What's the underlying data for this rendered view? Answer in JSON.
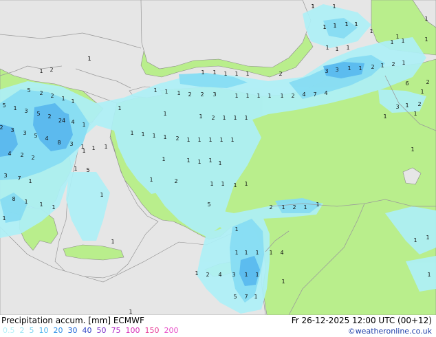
{
  "footer": {
    "title": "Precipitation accum. [mm] ECMWF",
    "valid": "Fr 26-12-2025 12:00 UTC (00+12)",
    "credit": "©weatheronline.co.uk"
  },
  "legend": [
    {
      "label": "0.5",
      "color": "#b5f0f8"
    },
    {
      "label": "2",
      "color": "#9be6f5"
    },
    {
      "label": "5",
      "color": "#7fd6f2"
    },
    {
      "label": "10",
      "color": "#4fb6ee"
    },
    {
      "label": "20",
      "color": "#2e8fe6"
    },
    {
      "label": "30",
      "color": "#1f66d8"
    },
    {
      "label": "40",
      "color": "#2a3fc4"
    },
    {
      "label": "50",
      "color": "#7a2fc8"
    },
    {
      "label": "75",
      "color": "#b52fc8"
    },
    {
      "label": "100",
      "color": "#d82fb8"
    },
    {
      "label": "150",
      "color": "#e83f98"
    },
    {
      "label": "200",
      "color": "#e84fc8"
    }
  ],
  "colors": {
    "sea": "#e6e6e6",
    "land": "#b9ee8c",
    "precip_light": "#aef0f7",
    "precip_medium": "#86dcf3",
    "precip_heavy": "#5ab9ee",
    "border": "#9a9a9a"
  },
  "map": {
    "values": [
      "1",
      "1",
      "1",
      "1",
      "1",
      "1",
      "1",
      "1",
      "1",
      "1",
      "1",
      "1",
      "2",
      "1",
      "1",
      "1",
      "1",
      "1",
      "2",
      "3",
      "3",
      "1",
      "1",
      "2",
      "1",
      "2",
      "1",
      "1",
      "1",
      "1",
      "2",
      "2",
      "3",
      "1",
      "1",
      "1",
      "1",
      "1",
      "2",
      "4",
      "7",
      "4",
      "6",
      "5",
      "2",
      "2",
      "1",
      "1",
      "5",
      "1",
      "3",
      "5",
      "2",
      "24",
      "4",
      "1",
      "2",
      "3",
      "3",
      "5",
      "4",
      "8",
      "3",
      "1",
      "4",
      "2",
      "2",
      "3",
      "7",
      "1",
      "3",
      "1",
      "2",
      "1",
      "1",
      "1",
      "2",
      "1",
      "1",
      "1",
      "1",
      "1",
      "1",
      "1",
      "1",
      "1",
      "1",
      "2",
      "1",
      "1",
      "1",
      "1",
      "1",
      "1",
      "1",
      "1",
      "1",
      "1",
      "1",
      "2",
      "1",
      "1",
      "1",
      "1",
      "1",
      "2",
      "1",
      "2",
      "1",
      "1",
      "5",
      "1",
      "5",
      "8",
      "1",
      "1",
      "1",
      "1",
      "1",
      "1",
      "1",
      "1",
      "4",
      "1",
      "2",
      "4",
      "3",
      "1",
      "1",
      "1",
      "1",
      "1",
      "1",
      "1",
      "5",
      "7",
      "1",
      "1",
      "2",
      "1",
      "1",
      "1",
      "1",
      "1",
      "1",
      "1",
      "1",
      "1",
      "1",
      "1",
      "1",
      "1",
      "1",
      "1",
      "1"
    ]
  }
}
